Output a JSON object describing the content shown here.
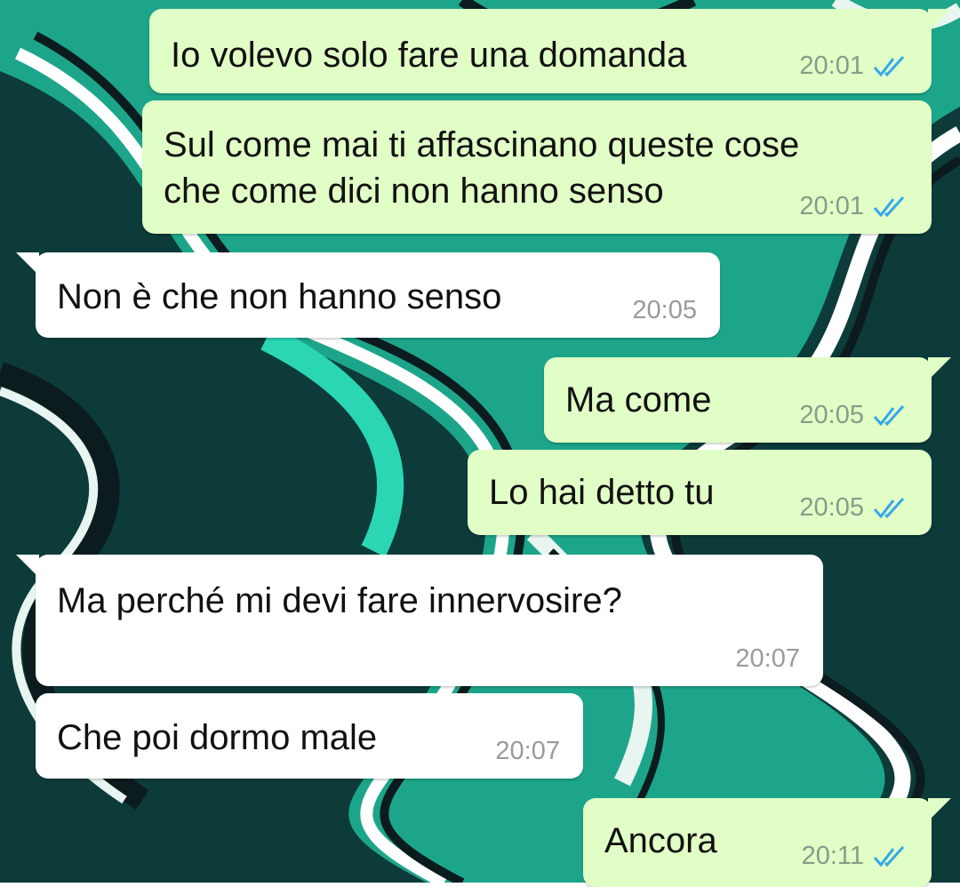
{
  "colors": {
    "outgoing_bubble": "#e1fec6",
    "incoming_bubble": "#ffffff",
    "read_ticks": "#35a7ea",
    "wallpaper_teal": "#1ca58a"
  },
  "messages": [
    {
      "direction": "outgoing",
      "text": "Io volevo solo fare una domanda",
      "time": "20:01",
      "status_icon": "double-check-read-icon"
    },
    {
      "direction": "outgoing",
      "text": "Sul come mai ti affascinano queste cose\nche come dici non hanno senso",
      "time": "20:01",
      "status_icon": "double-check-read-icon"
    },
    {
      "direction": "incoming",
      "text": "Non è che non hanno senso",
      "time": "20:05"
    },
    {
      "direction": "outgoing",
      "text": "Ma come",
      "time": "20:05",
      "status_icon": "double-check-read-icon"
    },
    {
      "direction": "outgoing",
      "text": "Lo hai detto tu",
      "time": "20:05",
      "status_icon": "double-check-read-icon"
    },
    {
      "direction": "incoming",
      "text": "Ma perché mi devi fare innervosire?",
      "time": "20:07"
    },
    {
      "direction": "incoming",
      "text": "Che poi dormo male",
      "time": "20:07"
    },
    {
      "direction": "outgoing",
      "text": "Ancora",
      "time": "20:11",
      "status_icon": "double-check-read-icon"
    }
  ]
}
